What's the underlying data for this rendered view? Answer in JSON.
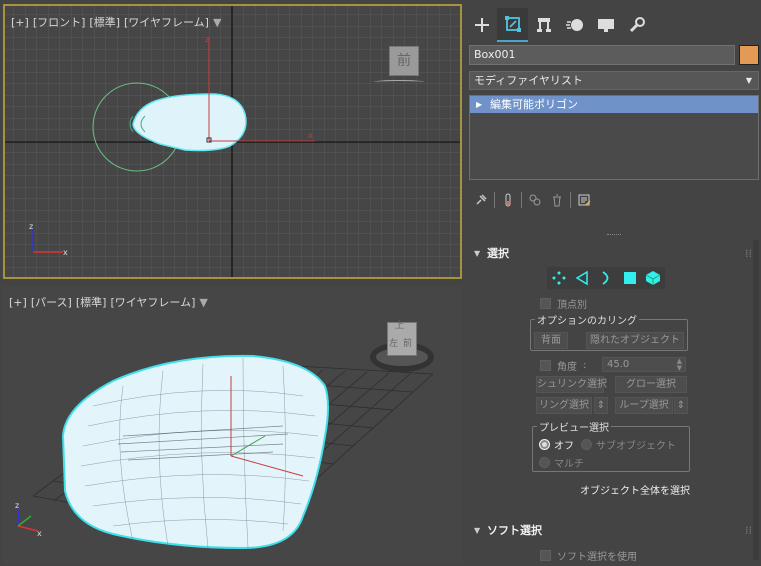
{
  "viewports": {
    "front": {
      "label": [
        "[+]",
        "[フロント]",
        "[標準]",
        "[ワイヤフレーム]"
      ],
      "viewcube_face": "前"
    },
    "perspective": {
      "label": [
        "[+]",
        "[パース]",
        "[標準]",
        "[ワイヤフレーム]"
      ],
      "viewcube_faces": [
        "上",
        "左",
        "前"
      ]
    }
  },
  "command_panel": {
    "tabs": [
      "create-icon",
      "modify-icon",
      "hierarchy-icon",
      "motion-icon",
      "display-icon",
      "utilities-icon"
    ],
    "active_tab": "modify-icon",
    "object_name": "Box001",
    "object_color": "#e39a55",
    "modifier_list": "モディファイヤリスト",
    "modifier_stack": [
      "編集可能ポリゴン"
    ],
    "stack_tools": [
      "pin-icon",
      "show-end-result-icon",
      "make-unique-icon",
      "remove-modifier-icon",
      "configure-sets-icon"
    ]
  },
  "rollouts": {
    "selection": {
      "title": "選択",
      "subobject_icons": [
        "vertex-icon",
        "edge-icon",
        "border-icon",
        "polygon-icon",
        "element-icon"
      ],
      "by_vertex": "頂点別",
      "culling_group": "オプションのカリング",
      "backface": "背面",
      "occluded": "隠れたオブジェクト",
      "angle_label": "角度",
      "angle_colon": ":",
      "angle_value": "45.0",
      "shrink": "シュリンク選択",
      "grow": "グロー選択",
      "ring": "リング選択",
      "loop": "ループ選択",
      "preview_group": "プレビュー選択",
      "preview_off": "オフ",
      "preview_subobject": "サブオブジェクト",
      "preview_multi": "マルチ",
      "select_all": "オブジェクト全体を選択"
    },
    "soft_selection": {
      "title": "ソフト選択",
      "use_soft": "ソフト選択を使用"
    }
  },
  "colors": {
    "accent": "#4aa6c8",
    "selection_mesh": "#4fe8f0",
    "active_viewport_border": "#a8933d",
    "stack_highlight": "#6f93c8"
  }
}
